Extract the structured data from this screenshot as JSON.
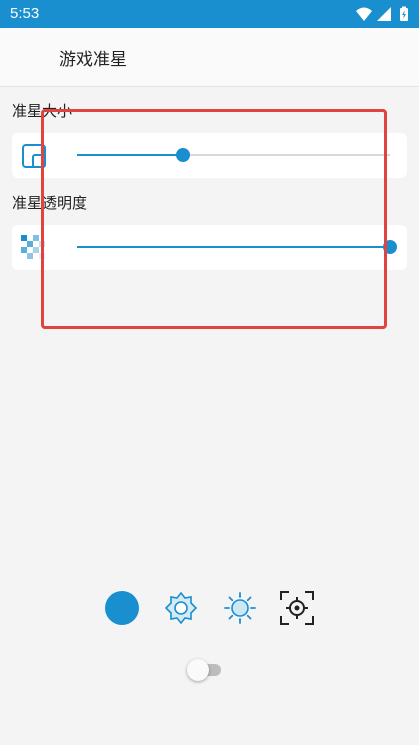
{
  "status_bar": {
    "time": "5:53",
    "icons": [
      "wifi-icon",
      "signal-icon",
      "battery-icon"
    ],
    "color": "#1a8fcf"
  },
  "app_bar": {
    "title": "游戏准星"
  },
  "crosshair_size": {
    "label": "准星大小",
    "icon": "crosshair-size-icon",
    "value_percent": 34
  },
  "crosshair_opacity": {
    "label": "准星透明度",
    "icon": "opacity-checker-icon",
    "value_percent": 100
  },
  "crosshair_styles": [
    {
      "icon": "filled-circle-icon",
      "selected": true
    },
    {
      "icon": "gear-crosshair-icon",
      "selected": false
    },
    {
      "icon": "sun-crosshair-icon",
      "selected": false
    },
    {
      "icon": "target-crosshair-icon",
      "selected": false
    }
  ],
  "toggle": {
    "on": false
  },
  "colors": {
    "accent": "#1a8fcf",
    "highlight": "#e0443f"
  }
}
